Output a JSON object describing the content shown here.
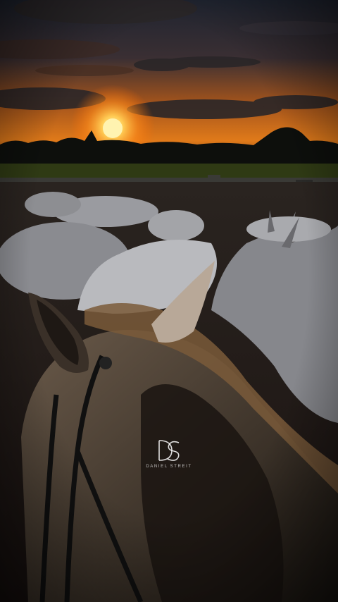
{
  "photo": {
    "subject": "cattle-and-horse-at-sunset",
    "colors": {
      "sky_top": "#1f2430",
      "sky_glow": "#ff9a1f",
      "sun": "#fff3b0",
      "cloud_dark": "#2a2628",
      "field": "#2f3a14",
      "treeline": "#0d0f0c",
      "cattle": "#bfc0c4",
      "horse_mane": "#7a5a3a",
      "ground": "#3a2a22"
    }
  },
  "watermark": {
    "monogram": "DS",
    "text": "DANIEL STREIT",
    "icon": "ds-monogram-logo"
  }
}
